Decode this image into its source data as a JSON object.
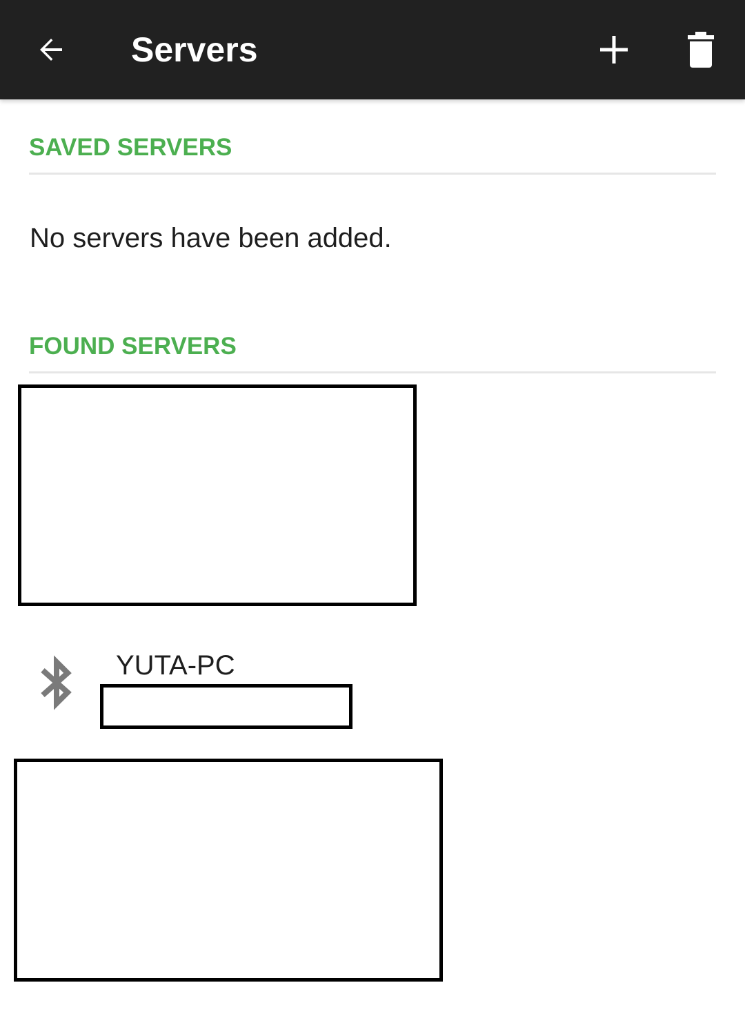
{
  "toolbar": {
    "title": "Servers",
    "back_icon": "arrow-back-icon",
    "add_icon": "plus-icon",
    "delete_icon": "trash-icon"
  },
  "saved_section": {
    "header": "SAVED SERVERS",
    "empty_message": "No servers have been added."
  },
  "found_section": {
    "header": "FOUND SERVERS",
    "servers": [
      {
        "name": "YUTA-PC",
        "icon": "bluetooth-icon"
      }
    ]
  },
  "colors": {
    "toolbar_bg": "#212121",
    "accent": "#4caf50",
    "divider": "#e6e6e6"
  }
}
